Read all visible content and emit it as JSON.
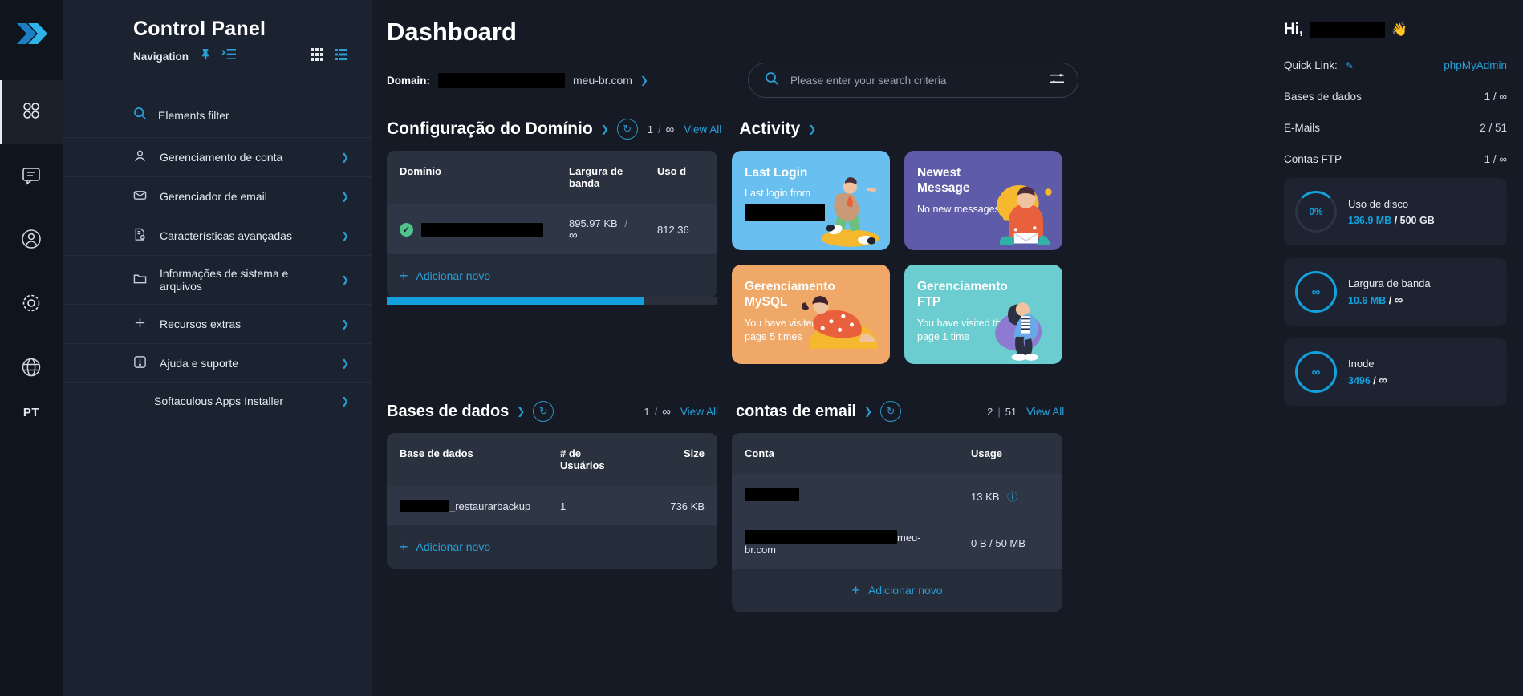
{
  "rail": {
    "logo_icon": "chevrons-right-logo",
    "items": [
      {
        "name": "apps-grid-icon",
        "active": true
      },
      {
        "name": "chat-icon",
        "active": false
      },
      {
        "name": "user-circle-icon",
        "active": false
      },
      {
        "name": "gear-icon",
        "active": false
      },
      {
        "name": "globe-icon",
        "active": false
      }
    ],
    "language": "PT"
  },
  "sidebar": {
    "title": "Control Panel",
    "subtitle": "Navigation",
    "pin_icon": "pin-icon",
    "collapse_icon": "list-collapse-icon",
    "grid_view_icon": "grid-view-icon",
    "list_view_icon": "list-view-icon",
    "filter_label": "Elements filter",
    "items": [
      {
        "label": "Gerenciamento de conta",
        "icon": "user-icon"
      },
      {
        "label": "Gerenciador de email",
        "icon": "envelope-icon"
      },
      {
        "label": "Características avançadas",
        "icon": "file-gear-icon"
      },
      {
        "label": "Informações de sistema e arquivos",
        "icon": "folder-icon"
      },
      {
        "label": "Recursos extras",
        "icon": "plus-icon"
      },
      {
        "label": "Ajuda e suporte",
        "icon": "alert-icon"
      },
      {
        "label": "Softaculous Apps Installer",
        "icon": ""
      }
    ]
  },
  "header": {
    "page_title": "Dashboard",
    "domain_label": "Domain:",
    "domain_value_redacted": true,
    "domain_suffix": "meu-br.com",
    "search_placeholder": "Please enter your search criteria",
    "search_value": "",
    "search_icon": "search-icon",
    "filter_icon": "sliders-icon"
  },
  "domain_section": {
    "title": "Configuração do Domínio",
    "count_used": "1",
    "count_total": "∞",
    "view_all": "View All",
    "columns": [
      "Domínio",
      "Largura de banda",
      "Uso d"
    ],
    "rows": [
      {
        "domain_redacted": true,
        "status": "ok",
        "bandwidth_used": "895.97 KB",
        "bandwidth_total": "∞",
        "usage": "812.36"
      }
    ],
    "add_new": "Adicionar novo",
    "progress_percent": 78
  },
  "activity_section": {
    "title": "Activity",
    "tiles": [
      {
        "title": "Last Login",
        "body": "Last login from",
        "has_redacted": true,
        "color": "#69c0f0",
        "art": "running-woman"
      },
      {
        "title": "Newest Message",
        "body": "No new messages",
        "has_redacted": false,
        "color": "#5e5ca8",
        "art": "woman-laptop"
      },
      {
        "title": "Gerenciamento MySQL",
        "body": "You have visited this page 5 times",
        "has_redacted": false,
        "color": "#f0a868",
        "art": "woman-orange"
      },
      {
        "title": "Gerenciamento FTP",
        "body": "You have visited this page 1 time",
        "has_redacted": false,
        "color": "#6bcdd0",
        "art": "skater"
      }
    ]
  },
  "databases_section": {
    "title": "Bases de dados",
    "count_used": "1",
    "count_total": "∞",
    "view_all": "View All",
    "columns": [
      "Base de dados",
      "# de Usuários",
      "Size"
    ],
    "rows": [
      {
        "name_redacted": true,
        "name_suffix": "_restaurarbackup",
        "users": "1",
        "size": "736 KB"
      }
    ],
    "add_new": "Adicionar novo"
  },
  "email_section": {
    "title": "contas de email",
    "count_used": "2",
    "count_total": "51",
    "view_all": "View All",
    "columns": [
      "Conta",
      "Usage"
    ],
    "rows": [
      {
        "account_redacted": true,
        "account_suffix": "",
        "usage": "13 KB",
        "has_info_icon": true
      },
      {
        "account_redacted": true,
        "account_suffix": "meu-br.com",
        "usage": "0 B / 50 MB",
        "has_info_icon": false
      }
    ],
    "add_new": "Adicionar novo"
  },
  "right_panel": {
    "greeting": "Hi,",
    "greeting_redacted": true,
    "wave_icon": "waving-hand-icon",
    "quick_link_label": "Quick Link:",
    "edit_icon": "pencil-icon",
    "quick_link_value": "phpMyAdmin",
    "stats": [
      {
        "label": "Bases de dados",
        "value": "1 / ∞"
      },
      {
        "label": "E-Mails",
        "value": "2 / 51"
      },
      {
        "label": "Contas FTP",
        "value": "1 / ∞"
      }
    ],
    "meters": [
      {
        "name": "Uso de disco",
        "ring": "0%",
        "used": "136.9 MB",
        "total": "500 GB",
        "ring_type": "percent"
      },
      {
        "name": "Largura de banda",
        "ring": "∞",
        "used": "10.6 MB",
        "total": "∞",
        "ring_type": "infinity"
      },
      {
        "name": "Inode",
        "ring": "∞",
        "used": "3496",
        "total": "∞",
        "ring_type": "infinity"
      }
    ]
  },
  "colors": {
    "accent": "#13a1de",
    "link": "#2a9fd6",
    "ok": "#4fc38a",
    "bg": "#151a24",
    "sidebar_bg": "#1b2230",
    "panel": "#252c3a"
  }
}
